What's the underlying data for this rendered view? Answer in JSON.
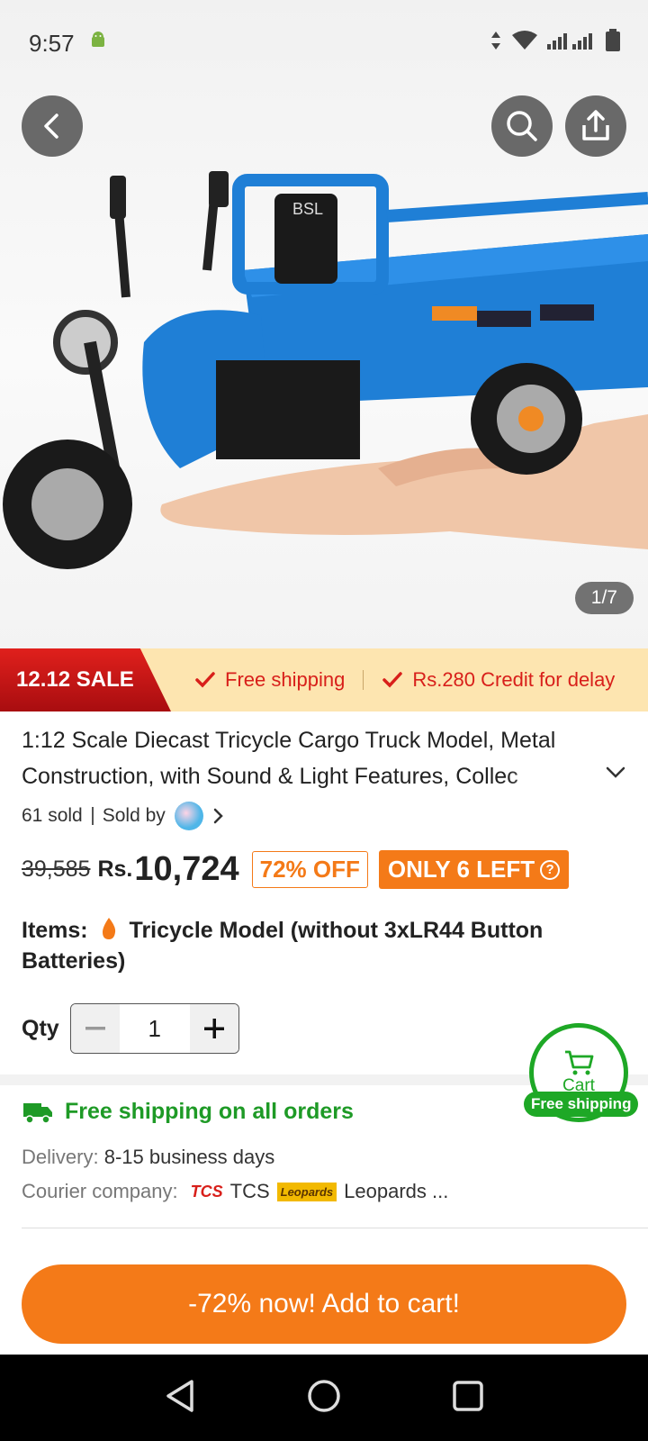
{
  "status_bar": {
    "time": "9:57"
  },
  "hero": {
    "image_counter": "1/7",
    "product_badge": "BSL"
  },
  "banner": {
    "sale_label": "12.12 SALE",
    "perk_1": "Free shipping",
    "perk_2": "Rs.280 Credit for delay"
  },
  "product": {
    "title": "1:12 Scale Diecast Tricycle Cargo Truck Model, Metal Construction, with Sound & Light Features, Collec",
    "sold_count": "61 sold",
    "sold_by_label": "Sold by",
    "original_price": "39,585",
    "currency": "Rs.",
    "price": "10,724",
    "discount": "72% OFF",
    "stock_badge": "ONLY 6 LEFT",
    "items_label": "Items:",
    "item_name": "Tricycle Model (without 3xLR44 Button Batteries)",
    "qty_label": "Qty",
    "qty_value": "1"
  },
  "floating_cart": {
    "label": "Cart",
    "tag": "Free shipping"
  },
  "shipping": {
    "title": "Free shipping on all orders",
    "delivery_label": "Delivery:",
    "delivery_value": "8-15 business days",
    "courier_label": "Courier company:",
    "courier_1_logo": "TCS",
    "courier_1": "TCS",
    "courier_2_logo": "Leopards",
    "courier_2": "Leopards ..."
  },
  "cta": {
    "label": "-72% now! Add to cart!"
  },
  "colors": {
    "accent": "#f47a18",
    "sale_red": "#d81f1a",
    "green": "#1ea826"
  }
}
